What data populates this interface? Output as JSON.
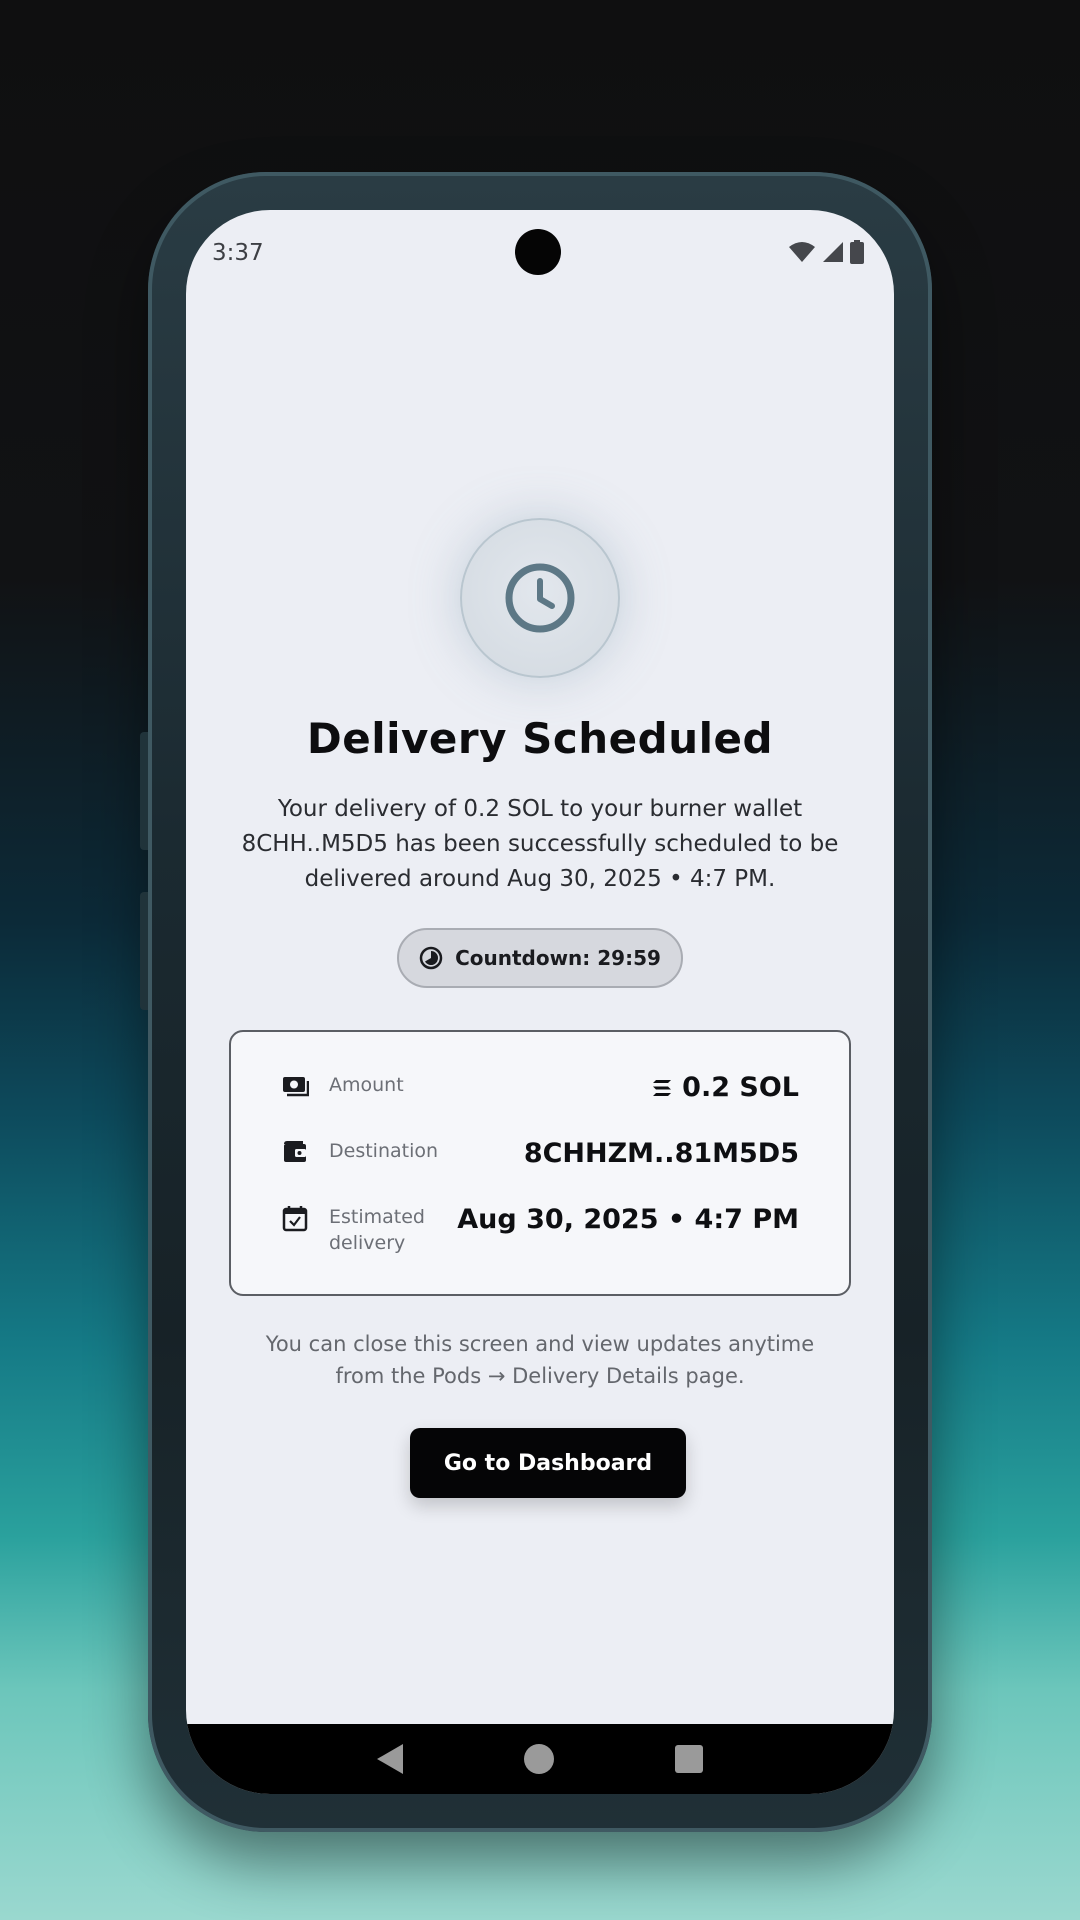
{
  "status_bar": {
    "time": "3:37",
    "icons": [
      "wifi-icon",
      "signal-icon",
      "battery-icon"
    ]
  },
  "header": {
    "icon": "clock-icon",
    "title": "Delivery Scheduled",
    "description": "Your delivery of 0.2 SOL to your burner wallet 8CHH..M5D5 has been successfully scheduled to be delivered around Aug 30, 2025 • 4:7 PM."
  },
  "countdown": {
    "icon": "timer-icon",
    "label": "Countdown: 29:59"
  },
  "details": [
    {
      "icon": "cash-icon",
      "label": "Amount",
      "value": "0.2 SOL",
      "value_icon": "solana-icon"
    },
    {
      "icon": "wallet-icon",
      "label": "Destination",
      "value": "8CHHZM..81M5D5"
    },
    {
      "icon": "calendar-check-icon",
      "label": "Estimated delivery",
      "value": "Aug 30, 2025 • 4:7 PM"
    }
  ],
  "note": "You can close this screen and view updates anytime from the Pods → Delivery Details page.",
  "actions": {
    "dashboard_label": "Go to Dashboard"
  },
  "nav": {
    "icons": [
      "back-icon",
      "home-icon",
      "recent-apps-icon"
    ]
  },
  "colors": {
    "screen_background": "#eceef4",
    "primary_button": "#050506",
    "clock_accent": "#5d7886"
  }
}
